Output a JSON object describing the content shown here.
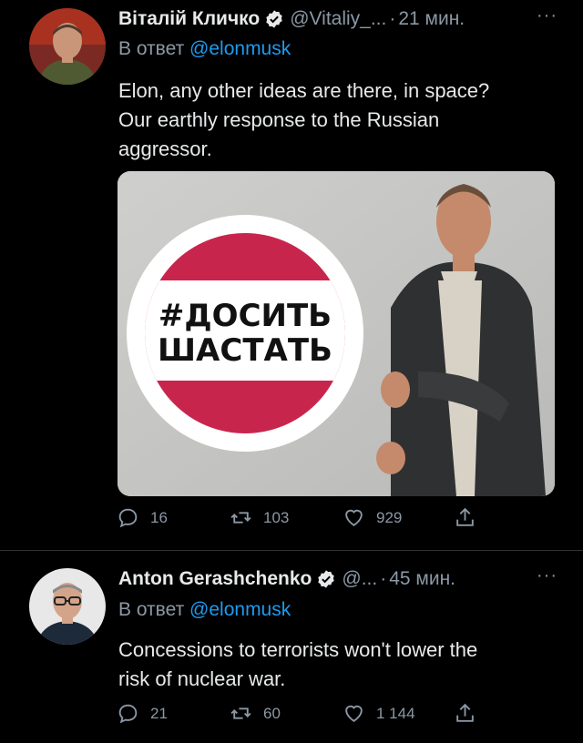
{
  "tweets": [
    {
      "author_name": "Віталій Кличко",
      "handle": "@Vitaliy_...",
      "separator": "·",
      "time": "21 мин.",
      "more": "···",
      "reply_prefix": "В ответ",
      "reply_to": "@elonmusk",
      "text": "Elon, any other ideas are there, in space?\nOur earthly response to the Russian\naggressor.",
      "image_text_line1": "#ДОСИТЬ",
      "image_text_line2": "ШАСТАТЬ",
      "replies": "16",
      "retweets": "103",
      "likes": "929"
    },
    {
      "author_name": "Anton Gerashchenko",
      "handle": "@...",
      "separator": "·",
      "time": "45 мин.",
      "more": "···",
      "reply_prefix": "В ответ",
      "reply_to": "@elonmusk",
      "text": "Concessions to terrorists won't lower the\nrisk of nuclear war.",
      "replies": "21",
      "retweets": "60",
      "likes": "1 144"
    }
  ],
  "icons": {
    "verified": "verified-badge-icon",
    "reply": "reply-bubble-icon",
    "retweet": "retweet-icon",
    "like": "heart-icon",
    "share": "share-icon",
    "more": "more-dots-icon"
  },
  "colors": {
    "background": "#000000",
    "text_primary": "#e7e9ea",
    "text_secondary": "#8b98a5",
    "mention": "#1d9bf0",
    "sign_red": "#c8254d"
  }
}
